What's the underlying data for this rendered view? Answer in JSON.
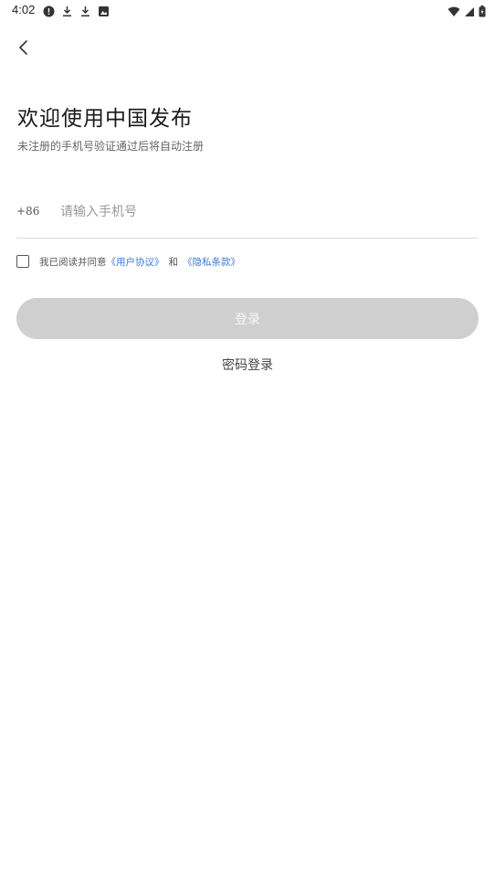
{
  "status_bar": {
    "time": "4:02",
    "left_icons": [
      "alert-icon",
      "download-icon",
      "download-icon",
      "image-icon"
    ],
    "right_icons": [
      "wifi-icon",
      "signal-icon",
      "battery-icon"
    ]
  },
  "header": {
    "back_icon": "chevron-left-icon"
  },
  "main": {
    "title": "欢迎使用中国发布",
    "subtitle": "未注册的手机号验证通过后将自动注册",
    "phone": {
      "country_code": "+86",
      "placeholder": "请输入手机号",
      "value": ""
    },
    "agreement": {
      "checked": false,
      "prefix": "我已阅读并同意",
      "user_agreement": "《用户协议》",
      "and": "和",
      "privacy_policy": "《隐私条款》"
    },
    "login_button": "登录",
    "password_login": "密码登录"
  },
  "colors": {
    "link": "#3a7be0",
    "button_disabled": "#cfcfcf",
    "divider": "#dcdcdc"
  }
}
